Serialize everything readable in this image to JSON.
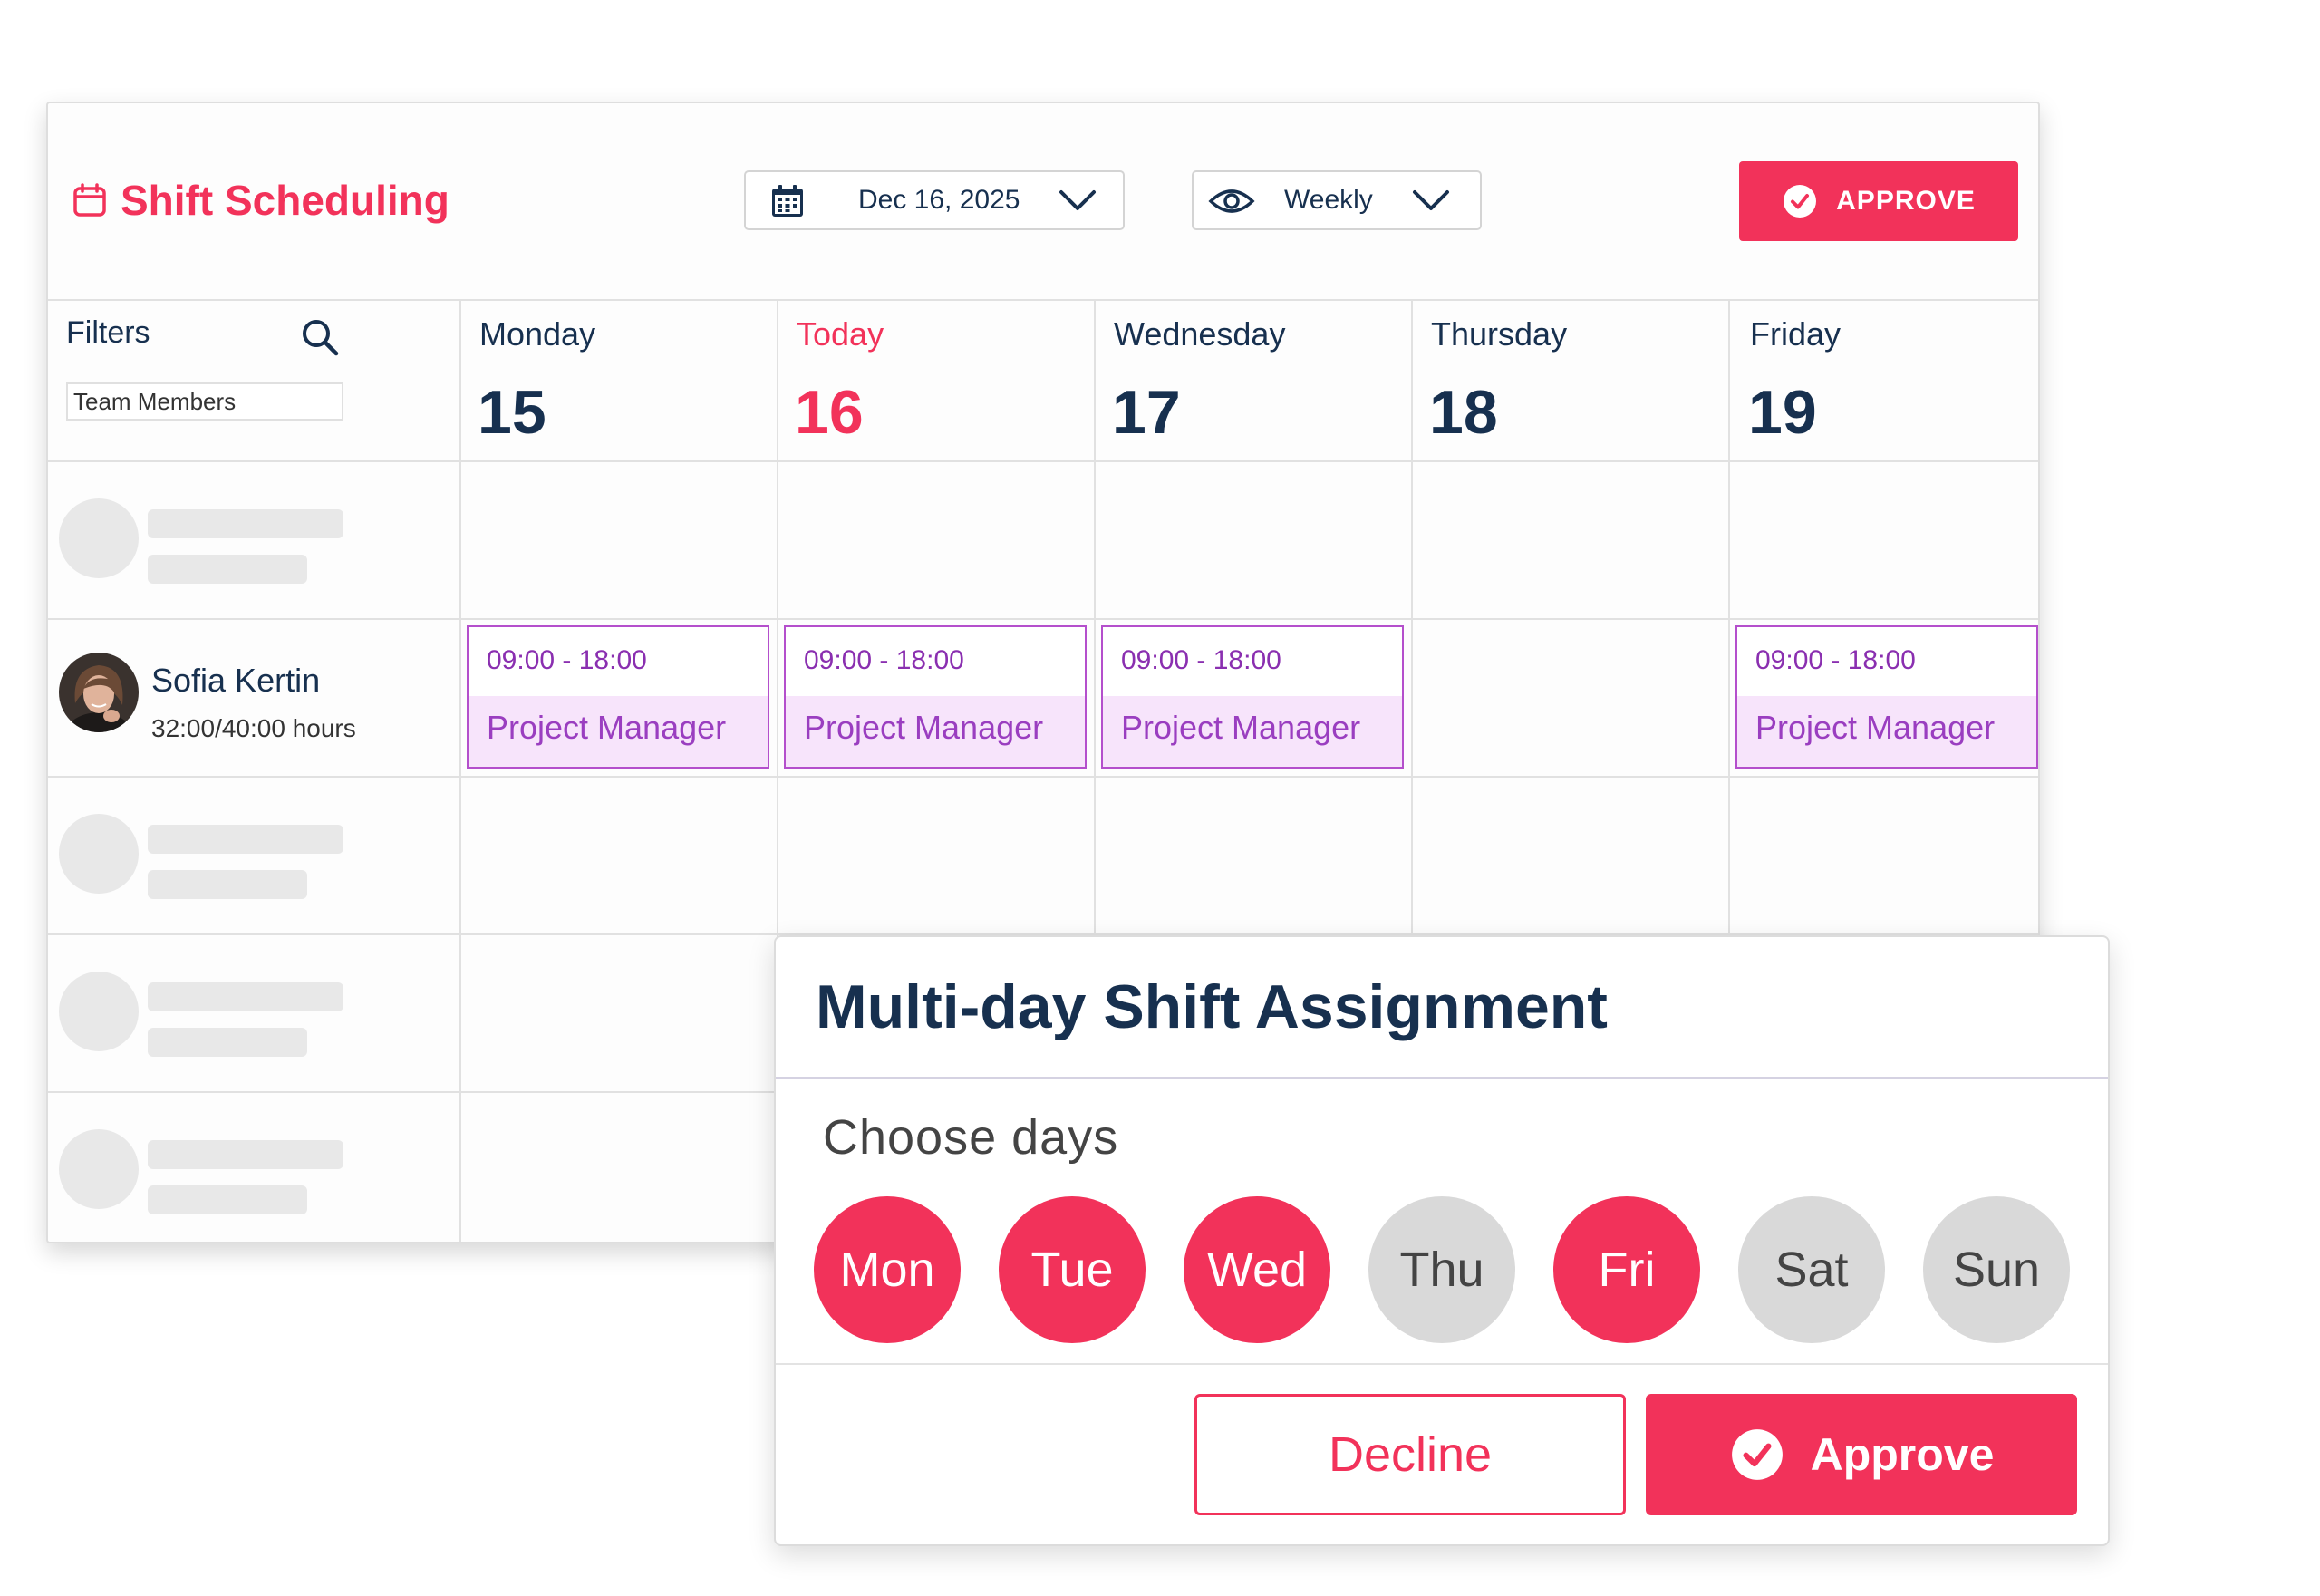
{
  "app": {
    "title": "Shift Scheduling",
    "icon": "calendar-icon"
  },
  "toolbar": {
    "date_value": "Dec 16, 2025",
    "view_value": "Weekly",
    "approve_label": "APPROVE"
  },
  "filters": {
    "label": "Filters",
    "team_placeholder": "Team Members"
  },
  "days": [
    {
      "name": "Monday",
      "number": "15",
      "is_today": false
    },
    {
      "name": "Today",
      "number": "16",
      "is_today": true
    },
    {
      "name": "Wednesday",
      "number": "17",
      "is_today": false
    },
    {
      "name": "Thursday",
      "number": "18",
      "is_today": false
    },
    {
      "name": "Friday",
      "number": "19",
      "is_today": false
    }
  ],
  "member": {
    "name": "Sofia Kertin",
    "hours": "32:00/40:00 hours"
  },
  "shifts": [
    {
      "time": "09:00 - 18:00",
      "role": "Project Manager"
    },
    {
      "time": "09:00 - 18:00",
      "role": "Project Manager"
    },
    {
      "time": "09:00 - 18:00",
      "role": "Project Manager"
    },
    {
      "time": "09:00 - 18:00",
      "role": "Project Manager"
    }
  ],
  "modal": {
    "title": "Multi-day Shift Assignment",
    "choose_label": "Choose days",
    "days": [
      {
        "label": "Mon",
        "selected": true
      },
      {
        "label": "Tue",
        "selected": true
      },
      {
        "label": "Wed",
        "selected": true
      },
      {
        "label": "Thu",
        "selected": false
      },
      {
        "label": "Fri",
        "selected": true
      },
      {
        "label": "Sat",
        "selected": false
      },
      {
        "label": "Sun",
        "selected": false
      }
    ],
    "decline_label": "Decline",
    "approve_label": "Approve"
  },
  "colors": {
    "accent": "#f2325a",
    "navy": "#17304f",
    "shift_border": "#b44fcc",
    "shift_fill": "#f7e4fb"
  }
}
